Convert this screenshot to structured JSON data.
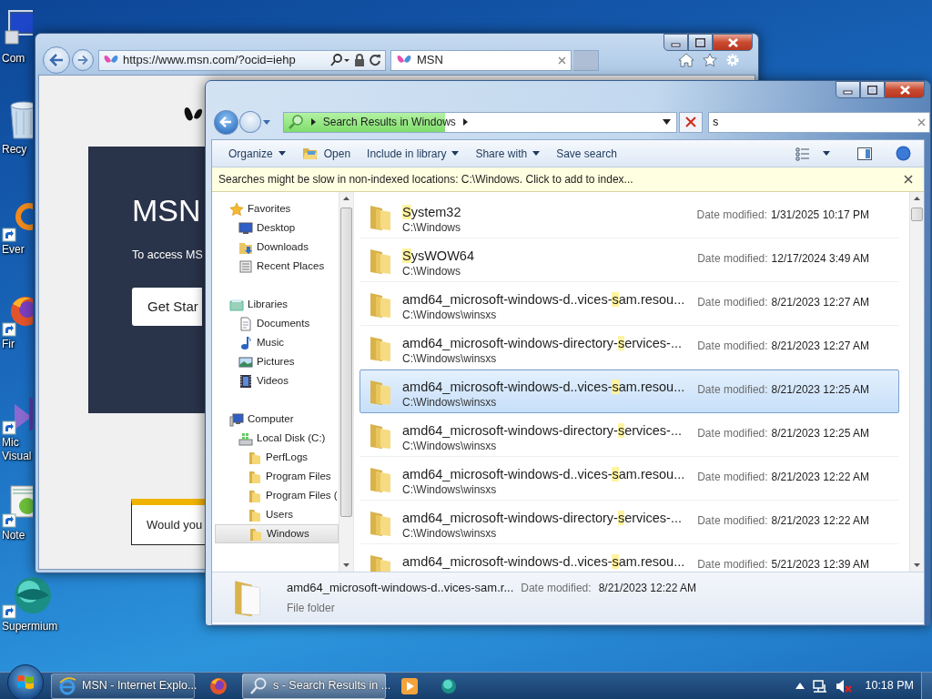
{
  "desktop_icons": [
    {
      "kind": "computer",
      "lines": [
        "Com"
      ]
    },
    {
      "kind": "recycle",
      "lines": [
        "Recy"
      ]
    },
    {
      "kind": "everything",
      "lines": [
        "Ever"
      ]
    },
    {
      "kind": "firefox",
      "lines": [
        "Fir"
      ]
    },
    {
      "kind": "visualstudio",
      "lines": [
        "Mic",
        "Visual"
      ]
    },
    {
      "kind": "notepad",
      "lines": [
        "Note"
      ]
    },
    {
      "kind": "supermium",
      "lines": [
        "Supermium"
      ]
    }
  ],
  "browser": {
    "address": "https://www.msn.com/?ocid=iehp",
    "tabs": [
      {
        "label": "MSN",
        "selected": true
      }
    ],
    "page": {
      "heading": "MSN",
      "text": "To access MS",
      "button": "Get Star",
      "popup": "Would you"
    }
  },
  "explorer": {
    "breadcrumb": "Search Results in Windows",
    "search_progress": {
      "level": 0.41
    },
    "search": {
      "value": "s"
    },
    "toolbar": [
      {
        "label": "Organize",
        "kind": "menu"
      },
      {
        "label": "Open",
        "kind": "open"
      },
      {
        "label": "Include in library",
        "kind": "menu"
      },
      {
        "label": "Share with",
        "kind": "menu"
      },
      {
        "label": "Save search",
        "kind": "plain"
      }
    ],
    "infobar": "Searches might be slow in non-indexed locations: C:\\Windows. Click to add to index...",
    "nav": [
      {
        "label": "Favorites",
        "kind": "star",
        "selected": false,
        "children": [
          {
            "label": "Desktop",
            "kind": "desktop",
            "selected": false
          },
          {
            "label": "Downloads",
            "kind": "downloads",
            "selected": false
          },
          {
            "label": "Recent Places",
            "kind": "recent",
            "selected": false
          }
        ]
      },
      {
        "label": "Libraries",
        "kind": "library",
        "selected": false,
        "children": [
          {
            "label": "Documents",
            "kind": "document",
            "selected": false
          },
          {
            "label": "Music",
            "kind": "music",
            "selected": false
          },
          {
            "label": "Pictures",
            "kind": "pictures",
            "selected": false
          },
          {
            "label": "Videos",
            "kind": "videos",
            "selected": false
          }
        ]
      },
      {
        "label": "Computer",
        "kind": "computer",
        "selected": false,
        "children": [
          {
            "label": "Local Disk (C:)",
            "kind": "disk",
            "selected": false,
            "children": [
              {
                "label": "PerfLogs",
                "kind": "folder",
                "selected": false
              },
              {
                "label": "Program Files",
                "kind": "folder",
                "selected": false
              },
              {
                "label": "Program Files (",
                "kind": "folder",
                "selected": false
              },
              {
                "label": "Users",
                "kind": "folder",
                "selected": false
              },
              {
                "label": "Windows",
                "kind": "folder",
                "selected": true
              }
            ]
          }
        ]
      }
    ],
    "results": [
      {
        "name": {
          "match": "S",
          "after": "ystem32"
        },
        "location": "C:\\Windows",
        "date_label": "Date modified:",
        "date": "1/31/2025 10:17 PM",
        "selected": false
      },
      {
        "name": {
          "match": "S",
          "after": "ysWOW64"
        },
        "location": "C:\\Windows",
        "date_label": "Date modified:",
        "date": "12/17/2024 3:49 AM",
        "selected": false
      },
      {
        "name": {
          "before": "amd64_microsoft-windows-d..vices-",
          "match": "s",
          "after": "am.resou..."
        },
        "location": "C:\\Windows\\winsxs",
        "date_label": "Date modified:",
        "date": "8/21/2023 12:27 AM",
        "selected": false
      },
      {
        "name": {
          "before": "amd64_microsoft-windows-directory-",
          "match": "s",
          "after": "ervices-..."
        },
        "location": "C:\\Windows\\winsxs",
        "date_label": "Date modified:",
        "date": "8/21/2023 12:27 AM",
        "selected": false
      },
      {
        "name": {
          "before": "amd64_microsoft-windows-d..vices-",
          "match": "s",
          "after": "am.resou..."
        },
        "location": "C:\\Windows\\winsxs",
        "date_label": "Date modified:",
        "date": "8/21/2023 12:25 AM",
        "selected": true
      },
      {
        "name": {
          "before": "amd64_microsoft-windows-directory-",
          "match": "s",
          "after": "ervices-..."
        },
        "location": "C:\\Windows\\winsxs",
        "date_label": "Date modified:",
        "date": "8/21/2023 12:25 AM",
        "selected": false
      },
      {
        "name": {
          "before": "amd64_microsoft-windows-d..vices-",
          "match": "s",
          "after": "am.resou..."
        },
        "location": "C:\\Windows\\winsxs",
        "date_label": "Date modified:",
        "date": "8/21/2023 12:22 AM",
        "selected": false
      },
      {
        "name": {
          "before": "amd64_microsoft-windows-directory-",
          "match": "s",
          "after": "ervices-..."
        },
        "location": "C:\\Windows\\winsxs",
        "date_label": "Date modified:",
        "date": "8/21/2023 12:22 AM",
        "selected": false
      },
      {
        "name": {
          "before": "amd64_microsoft-windows-d..vices-",
          "match": "s",
          "after": "am.resou..."
        },
        "date_label": "Date modified:",
        "date": "5/21/2023 12:39 AM",
        "selected": false
      }
    ],
    "details": {
      "name": "amd64_microsoft-windows-d..vices-sam.r...",
      "date_label": "Date modified:",
      "date": "8/21/2023 12:22 AM",
      "type": "File folder"
    }
  },
  "taskbar": {
    "items": [
      {
        "kind": "ie",
        "label": "MSN - Internet Explo...",
        "selected": false
      },
      {
        "kind": "firefox",
        "selected": false
      },
      {
        "kind": "explorer",
        "label": "s - Search Results in ...",
        "selected": true
      },
      {
        "kind": "media",
        "selected": false
      },
      {
        "kind": "supermium",
        "selected": false
      }
    ],
    "clock": "10:18 PM"
  }
}
